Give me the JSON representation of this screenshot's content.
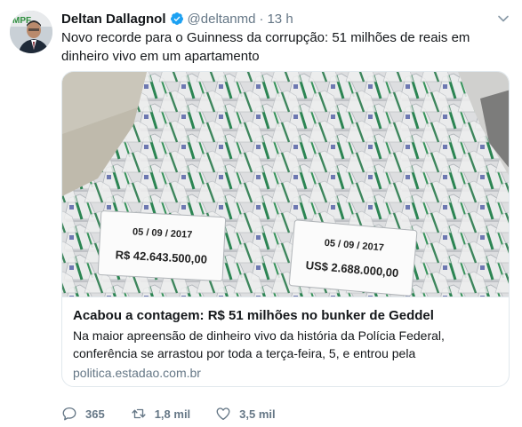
{
  "tweet": {
    "author": {
      "name": "Deltan Dallagnol",
      "handle": "@deltanmd",
      "avatar_text": "MPF",
      "verified_icon": "verified-badge-icon"
    },
    "separator": "·",
    "time": "13 h",
    "text": "Novo recorde para o Guinness da corrupção: 51 milhões de reais em dinheiro vivo em um apartamento",
    "card": {
      "title": "Acabou a contagem: R$ 51 milhões no bunker de Geddel",
      "description": "Na maior apreensão de dinheiro vivo da história da Polícia Federal, conferência se arrastou por toda a terça-feira, 5, e entrou pela",
      "domain": "politica.estadao.com.br",
      "image": {
        "note_left_date": "05 / 09 / 2017",
        "note_left_amount": "R$ 42.643.500,00",
        "note_right_date": "05 / 09 / 2017",
        "note_right_amount": "US$ 2.688.000,00"
      }
    },
    "actions": {
      "replies": "365",
      "retweets": "1,8 mil",
      "likes": "3,5 mil"
    }
  },
  "colors": {
    "text": "#14171a",
    "muted": "#657786",
    "verified": "#1da1f2",
    "border": "#e1e8ed"
  }
}
